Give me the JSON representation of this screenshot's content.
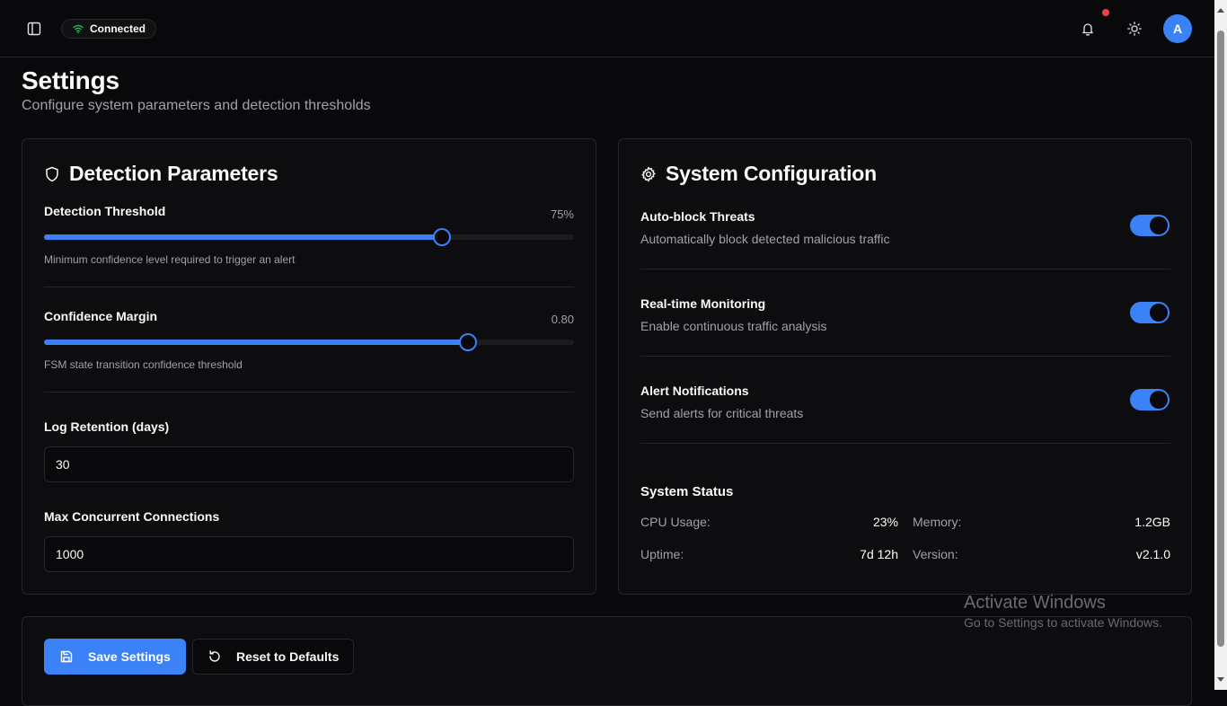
{
  "header": {
    "connection_status": "Connected",
    "avatar_initial": "A",
    "icons": [
      "sidebar-toggle-icon",
      "wifi-icon",
      "bell-icon",
      "sun-icon"
    ],
    "status_color": "#22c55e",
    "notification_dot_color": "#ef4444"
  },
  "page": {
    "title": "Settings",
    "subtitle": "Configure system parameters and detection thresholds"
  },
  "detection": {
    "title": "Detection Parameters",
    "icon": "shield-icon",
    "threshold": {
      "label": "Detection Threshold",
      "value_text": "75%",
      "value": 0.75,
      "help": "Minimum confidence level required to trigger an alert"
    },
    "confidence_margin": {
      "label": "Confidence Margin",
      "value_text": "0.80",
      "value": 0.8,
      "help": "FSM state transition confidence threshold"
    },
    "log_retention": {
      "label": "Log Retention (days)",
      "value": "30"
    },
    "max_connections": {
      "label": "Max Concurrent Connections",
      "value": "1000"
    }
  },
  "system": {
    "title": "System Configuration",
    "icon": "gear-icon",
    "toggles": [
      {
        "title": "Auto-block Threats",
        "desc": "Automatically block detected malicious traffic",
        "on": true
      },
      {
        "title": "Real-time Monitoring",
        "desc": "Enable continuous traffic analysis",
        "on": true
      },
      {
        "title": "Alert Notifications",
        "desc": "Send alerts for critical threats",
        "on": true
      }
    ],
    "status": {
      "title": "System Status",
      "cpu_label": "CPU Usage:",
      "cpu_value": "23%",
      "memory_label": "Memory:",
      "memory_value": "1.2GB",
      "uptime_label": "Uptime:",
      "uptime_value": "7d 12h",
      "version_label": "Version:",
      "version_value": "v2.1.0"
    }
  },
  "actions": {
    "save_label": "Save Settings",
    "reset_label": "Reset to Defaults"
  },
  "watermark": {
    "line1": "Activate Windows",
    "line2": "Go to Settings to activate Windows."
  },
  "colors": {
    "accent": "#3b82f6",
    "background": "#09090b",
    "card": "#0d0d10",
    "border": "#27272a"
  }
}
